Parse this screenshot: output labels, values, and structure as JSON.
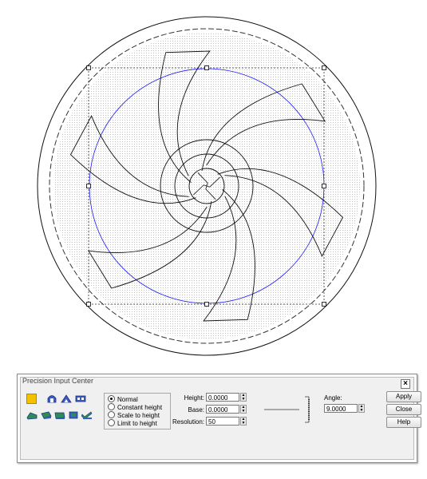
{
  "drawing": {
    "colors": {
      "line": "#111111",
      "dash": "#333333",
      "hatch": "#7a7a7a",
      "guide_circle": "#0000ff"
    },
    "blade_count": 6
  },
  "panel": {
    "title": "Precision Input Center",
    "close_label": "×",
    "toolbar": {
      "icons": [
        "yellow-square-icon",
        "arch-icon",
        "peak-icon",
        "rect-solid-icon",
        "shape-a-icon",
        "shape-b-icon",
        "shape-c-icon",
        "shape-d-icon",
        "shape-e-icon"
      ]
    },
    "mode_options": [
      {
        "label": "Normal",
        "selected": true
      },
      {
        "label": "Constant height",
        "selected": false
      },
      {
        "label": "Scale to height",
        "selected": false
      },
      {
        "label": "Limit to height",
        "selected": false
      }
    ],
    "fields": {
      "height": {
        "label": "Height:",
        "value": "0.0000"
      },
      "base": {
        "label": "Base:",
        "value": "0.0000"
      },
      "resolution": {
        "label": "Resolution:",
        "value": "50"
      },
      "angle": {
        "label": "Angle:",
        "value": "9.0000"
      }
    },
    "buttons": {
      "apply": "Apply",
      "close": "Close",
      "help": "Help"
    }
  }
}
